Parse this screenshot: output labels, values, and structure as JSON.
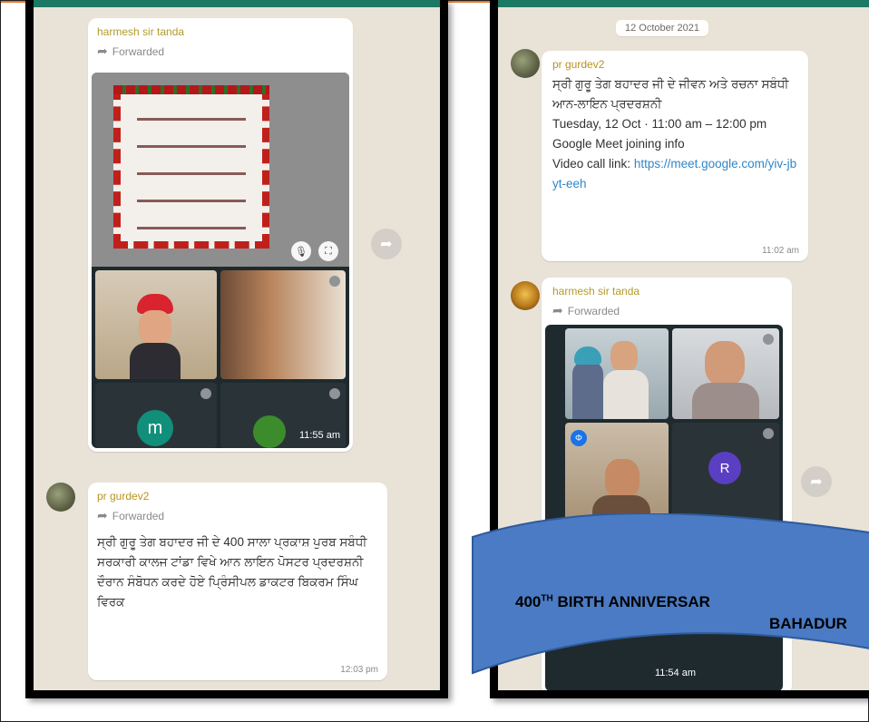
{
  "left_chat": {
    "msg1": {
      "sender": "harmesh sir tanda",
      "forwarded": "Forwarded",
      "time": "11:55 am",
      "participant_initial": "m"
    },
    "msg2": {
      "sender": "pr gurdev2",
      "forwarded": "Forwarded",
      "text": "ਸ੍ਰੀ ਗੁਰੂ ਤੇਗ ਬਹਾਦਰ ਜੀ ਦੇ 400 ਸਾਲਾ ਪ੍ਰਕਾਸ਼ ਪੁਰਬ ਸਬੰਧੀ ਸਰਕਾਰੀ ਕਾਲਜ ਟਾਂਡਾ ਵਿਖੇ ਆਨ ਲਾਇਨ ਪੋਸਟਰ ਪ੍ਰਦਰਸ਼ਨੀ ਦੌਰਾਨ ਸੰਬੋਧਨ ਕਰਦੇ ਹੋਏ ਪ੍ਰਿੰਸੀਪਲ ਡਾਕਟਰ ਬਿਕਰਮ ਸਿੰਘ ਵਿਰਕ",
      "time": "12:03 pm"
    }
  },
  "right_chat": {
    "date": "12 October 2021",
    "msg1": {
      "sender": "pr gurdev2",
      "title": "ਸ੍ਰੀ ਗੁਰੂ ਤੇਗ ਬਹਾਦਰ ਜੀ ਦੇ ਜੀਵਨ ਅਤੇ ਰਚਨਾ ਸਬੰਧੀ ਆਨ-ਲਾਇਨ ਪ੍ਰਦਰਸ਼ਨੀ",
      "when": "Tuesday, 12 Oct · 11:00 am – 12:00 pm",
      "meet": "Google Meet joining info",
      "link_label": "Video call link: ",
      "link": "https://meet.google.com/yiv-jbyt-eeh",
      "time": "11:02 am"
    },
    "msg2": {
      "sender": "harmesh sir tanda",
      "forwarded": "Forwarded",
      "participant_initial": "R",
      "time": "11:54 am"
    }
  },
  "banner": {
    "line1_prefix": "400",
    "line1_sup": "TH",
    "line1_rest": " BIRTH ANNIVERSAR",
    "line2": "BAHADUR",
    "color": "#4a7bc4"
  },
  "icons": {
    "share": "share-icon",
    "forward": "forward-arrow-icon",
    "mic": "mic-icon",
    "fullscreen": "fullscreen-icon"
  }
}
